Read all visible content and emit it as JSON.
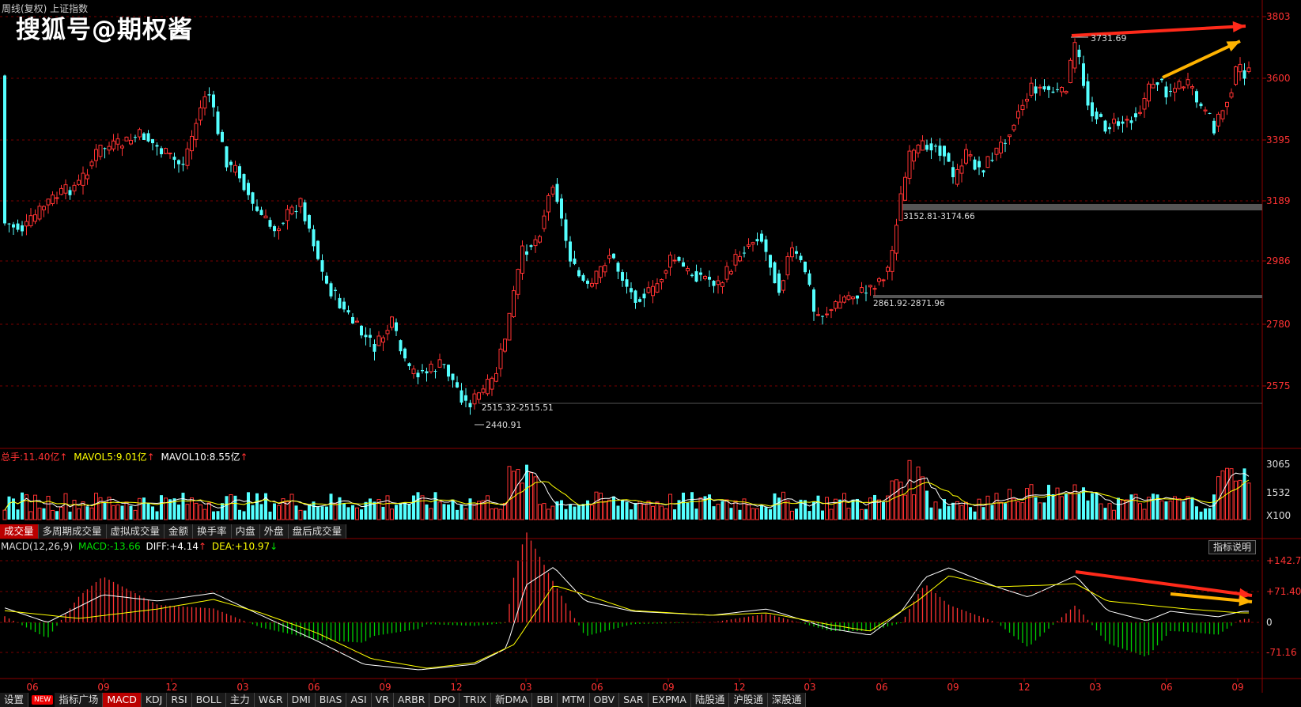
{
  "header": {
    "chart_title": "周线(复权) 上证指数",
    "watermark": "搜狐号@期权酱"
  },
  "price_axis_labels": [
    "3803",
    "3600",
    "3395",
    "3189",
    "2986",
    "2780",
    "2575"
  ],
  "annotations": {
    "high": "3731.69",
    "low": "2440.91",
    "zone_upper": "3152.81-3174.66",
    "zone_middle": "2861.92-2871.96",
    "zone_lower": "2515.32-2515.51"
  },
  "volume_header": {
    "total_label": "总手:",
    "total_value": "11.40亿",
    "mavol5_label": "MAVOL5:",
    "mavol5_value": "9.01亿",
    "mavol10_label": "MAVOL10:",
    "mavol10_value": "8.55亿",
    "arrow": "↑"
  },
  "volume_axis_labels": [
    "3065",
    "1532",
    "X100"
  ],
  "volume_tabs": [
    "成交量",
    "多周期成交量",
    "虚拟成交量",
    "金额",
    "换手率",
    "内盘",
    "外盘",
    "盘后成交量"
  ],
  "macd_header": {
    "params": "MACD(12,26,9)",
    "macd_label": "MACD:",
    "macd_value": "-13.66",
    "diff_label": "DIFF:",
    "diff_value": "+4.14",
    "dea_label": "DEA:",
    "dea_value": "+10.97",
    "up_arrow": "↑",
    "down_arrow": "↓"
  },
  "macd_button": "指标说明",
  "macd_axis_labels": [
    "+142.7",
    "+71.40",
    "0",
    "-71.16"
  ],
  "time_axis_labels": [
    "06",
    "09",
    "12",
    "03",
    "06",
    "09",
    "12",
    "03",
    "06",
    "09",
    "12",
    "03",
    "06",
    "09",
    "12",
    "03",
    "06",
    "09"
  ],
  "bottom_tabs": {
    "settings": "设置",
    "new_badge": "NEW",
    "items": [
      "指标广场",
      "MACD",
      "KDJ",
      "RSI",
      "BOLL",
      "主力",
      "W&R",
      "DMI",
      "BIAS",
      "ASI",
      "VR",
      "ARBR",
      "DPO",
      "TRIX",
      "新DMA",
      "BBI",
      "MTM",
      "OBV",
      "SAR",
      "EXPMA",
      "陆股通",
      "沪股通",
      "深股通"
    ],
    "active": "MACD"
  },
  "colors": {
    "up": "#ff3232",
    "down": "#54ffff",
    "ma_white": "#ffffff",
    "ma_yellow": "#ffff00",
    "grid": "#7a0000",
    "arrow_red": "#ff2a1a",
    "arrow_orange": "#ffb300"
  }
}
